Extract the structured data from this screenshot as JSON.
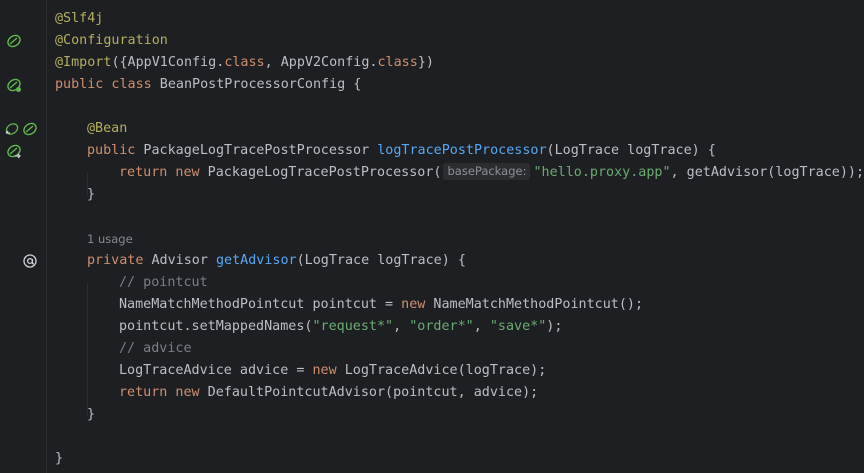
{
  "editor": {
    "usage_hint": "1 usage",
    "param_hint": "basePackage:",
    "lines": {
      "l1_ann": "@Slf4j",
      "l2_ann": "@Configuration",
      "l3_ann": "@Import",
      "l3_a": "({AppV1Config.",
      "l3_kw1": "class",
      "l3_b": ", AppV2Config.",
      "l3_kw2": "class",
      "l3_c": "})",
      "l4_kw": "public class",
      "l4_rest": " BeanPostProcessorConfig {",
      "l6_ann": "@Bean",
      "l7_kw": "public",
      "l7_type": " PackageLogTracePostProcessor ",
      "l7_fn": "logTracePostProcessor",
      "l7_rest": "(LogTrace logTrace) {",
      "l8_kw": "return new",
      "l8_a": " PackageLogTracePostProcessor(",
      "l8_str": "\"hello.proxy.app\"",
      "l8_b": ", getAdvisor(logTrace));",
      "l9": "}",
      "l12_kw": "private",
      "l12_type": " Advisor ",
      "l12_fn": "getAdvisor",
      "l12_rest": "(LogTrace logTrace) {",
      "l13_cmt": "// pointcut",
      "l14_a": "NameMatchMethodPointcut pointcut = ",
      "l14_kw": "new",
      "l14_b": " NameMatchMethodPointcut();",
      "l15_a": "pointcut.setMappedNames(",
      "l15_s1": "\"request*\"",
      "l15_c1": ", ",
      "l15_s2": "\"order*\"",
      "l15_c2": ", ",
      "l15_s3": "\"save*\"",
      "l15_b": ");",
      "l16_cmt": "// advice",
      "l17_a": "LogTraceAdvice advice = ",
      "l17_kw": "new",
      "l17_b": " LogTraceAdvice(logTrace);",
      "l18_kw": "return new",
      "l18_rest": " DefaultPointcutAdvisor(pointcut, advice);",
      "l19": "}",
      "l21": "}"
    }
  },
  "gutter_icons": [
    "spring-bean-icon",
    "spring-config-icon",
    "navigate-back-icon",
    "spring-bean-method-icon",
    "override-at-icon"
  ],
  "colors": {
    "background": "#1e1f22",
    "keyword": "#cf8e6d",
    "annotation": "#b3ae60",
    "function": "#56a8f5",
    "string": "#6aab73",
    "comment": "#7a7e85",
    "gutter_icon": "#5fb84d"
  }
}
